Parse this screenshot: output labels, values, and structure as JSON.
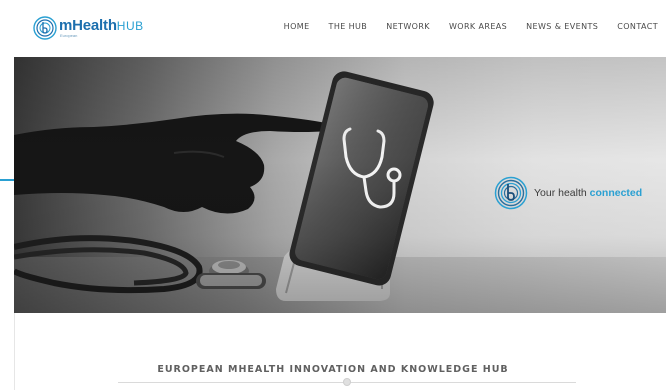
{
  "brand": {
    "name_main": "mHealth",
    "name_hub": "HUB",
    "sub": "European"
  },
  "nav": {
    "items": [
      "HOME",
      "THE HUB",
      "NETWORK",
      "WORK AREAS",
      "NEWS & EVENTS",
      "CONTACT"
    ]
  },
  "hero": {
    "tagline_prefix": "Your health",
    "tagline_accent": "connected"
  },
  "section": {
    "title": "EUROPEAN MHEALTH INNOVATION AND KNOWLEDGE HUB"
  },
  "colors": {
    "accent": "#2aa0d2",
    "brand_dark": "#1c6fae"
  },
  "icons": [
    "mhealthhub-logo-icon",
    "stethoscope-icon",
    "hub-emblem-icon"
  ]
}
